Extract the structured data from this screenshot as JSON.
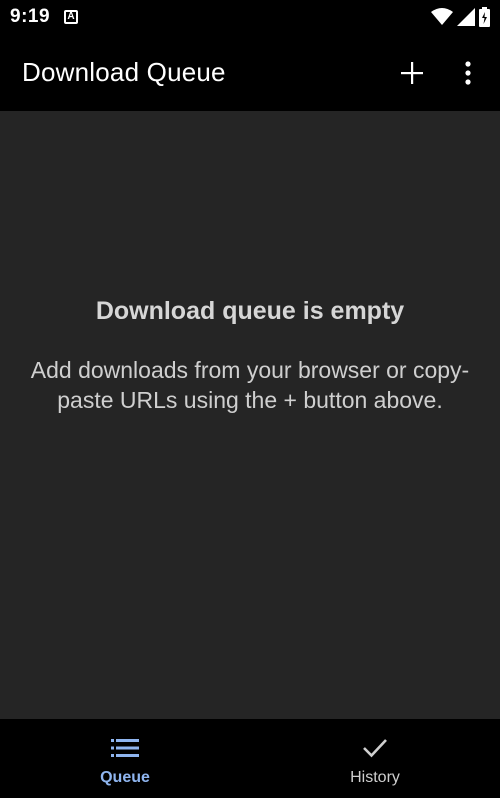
{
  "status_bar": {
    "time": "9:19",
    "notification_icon": "A",
    "icons": [
      "wifi-icon",
      "cell-signal-icon",
      "battery-icon"
    ]
  },
  "app_bar": {
    "title": "Download Queue",
    "actions": [
      "add-icon",
      "more-vert-icon"
    ]
  },
  "empty_state": {
    "title": "Download queue is empty",
    "description": "Add downloads from your browser or copy-paste URLs using the + button above."
  },
  "bottom_nav": {
    "items": [
      {
        "label": "Queue",
        "icon": "list-icon",
        "active": true
      },
      {
        "label": "History",
        "icon": "check-icon",
        "active": false
      }
    ]
  },
  "colors": {
    "background": "#000000",
    "content_background": "#252525",
    "accent": "#8fb5ef",
    "text_primary": "#ffffff",
    "text_secondary": "#cfcfcf"
  }
}
